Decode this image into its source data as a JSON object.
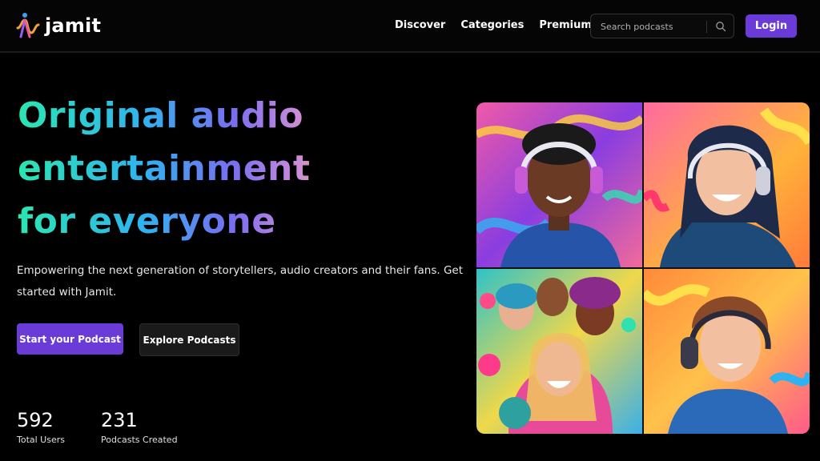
{
  "brand": {
    "name": "jamit"
  },
  "nav": {
    "items": [
      {
        "label": "Discover"
      },
      {
        "label": "Categories"
      },
      {
        "label": "Premium"
      }
    ]
  },
  "search": {
    "placeholder": "Search podcasts",
    "icon": "search-icon"
  },
  "login": {
    "label": "Login"
  },
  "hero": {
    "headline_line1": "Original audio",
    "headline_line2": "entertainment",
    "headline_line3": "for everyone",
    "subtext": "Empowering the next generation of storytellers, audio creators and their fans. Get started with Jamit.",
    "primary_cta": "Start your Podcast",
    "secondary_cta": "Explore Podcasts"
  },
  "stats": [
    {
      "value": "592",
      "label": "Total Users"
    },
    {
      "value": "231",
      "label": "Podcasts Created"
    }
  ],
  "colors": {
    "accent": "#6a3bd6",
    "background": "#000000",
    "gradient": [
      "#2be6b0",
      "#2fb3f0",
      "#7a6df0",
      "#c98bdb",
      "#f6c04a",
      "#ffd83a"
    ]
  },
  "gallery": {
    "tiles": [
      {
        "name": "man-with-headphones-illustration"
      },
      {
        "name": "woman-with-headphones-illustration"
      },
      {
        "name": "group-laughing-illustration"
      },
      {
        "name": "young-man-with-headphones-illustration"
      }
    ]
  }
}
